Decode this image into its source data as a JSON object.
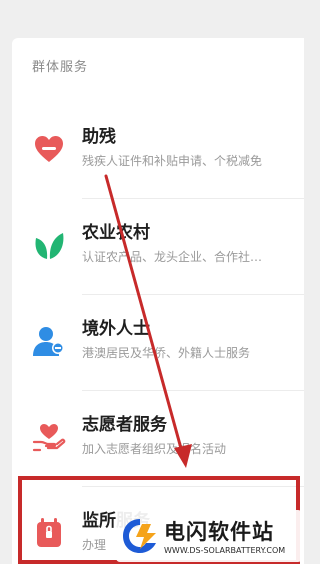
{
  "section": {
    "title": "群体服务"
  },
  "items": [
    {
      "title": "助残",
      "desc": "残疾人证件和补贴申请、个税减免",
      "icon": "heart-icon",
      "color": "#e85a5a"
    },
    {
      "title": "农业农村",
      "desc": "认证农产品、龙头企业、合作社…",
      "icon": "leaf-icon",
      "color": "#22b573"
    },
    {
      "title": "境外人士",
      "desc": "港澳居民及华侨、外籍人士服务",
      "icon": "person-icon",
      "color": "#2f8de4"
    },
    {
      "title": "志愿者服务",
      "desc": "加入志愿者组织及报名活动",
      "icon": "hand-heart-icon",
      "color": "#e85a5a"
    },
    {
      "title": "监所服务",
      "desc": "办理",
      "icon": "prison-icon",
      "color": "#e85a5a"
    }
  ],
  "annotation": {
    "highlight_color": "#c72a2a"
  },
  "watermark": {
    "title": "电闪软件站",
    "url": "WWW.DS-SOLARBATTERY.COM"
  }
}
